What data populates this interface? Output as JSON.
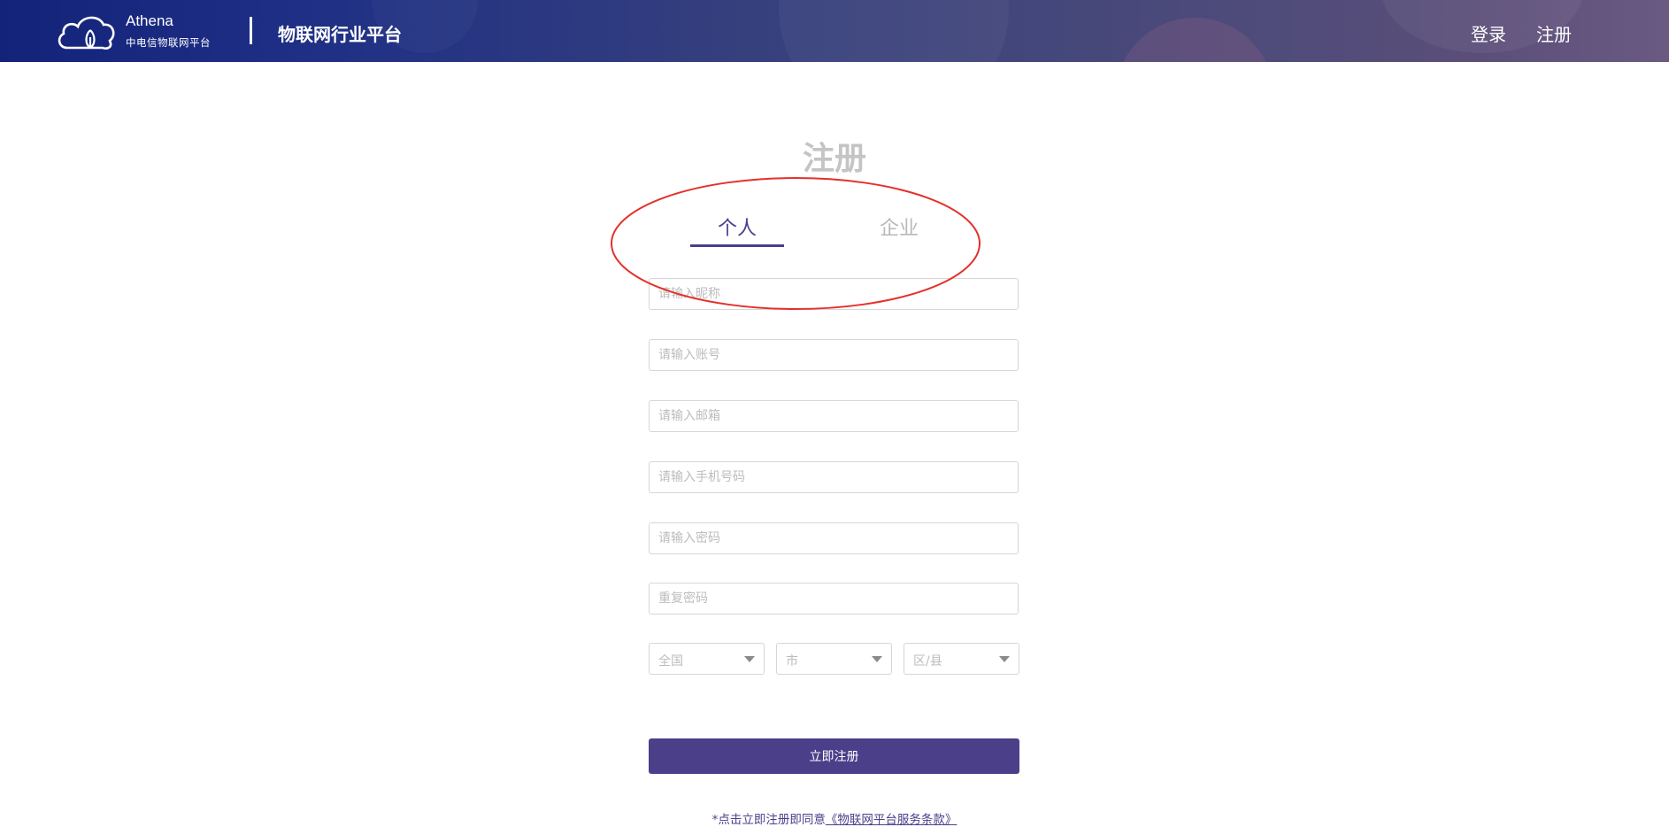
{
  "header": {
    "brand_name": "Athena",
    "brand_sub": "中电信物联网平台",
    "platform_title": "物联网行业平台",
    "nav": {
      "login": "登录",
      "register": "注册"
    }
  },
  "page": {
    "title": "注册",
    "tabs": [
      {
        "label": "个人",
        "active": true
      },
      {
        "label": "企业",
        "active": false
      }
    ]
  },
  "form": {
    "nickname_placeholder": "请输入昵称",
    "account_placeholder": "请输入账号",
    "email_placeholder": "请输入邮箱",
    "phone_placeholder": "请输入手机号码",
    "password_placeholder": "请输入密码",
    "repeat_password_placeholder": "重复密码",
    "region": {
      "province": "全国",
      "city": "市",
      "district": "区/县"
    },
    "submit_label": "立即注册",
    "terms_prefix": "*点击立即注册即同意",
    "terms_link": "《物联网平台服务条款》"
  },
  "colors": {
    "accent": "#4b3f8a",
    "annotation": "#e5302b",
    "header_start": "#14237a",
    "header_end": "#6a5a82"
  }
}
